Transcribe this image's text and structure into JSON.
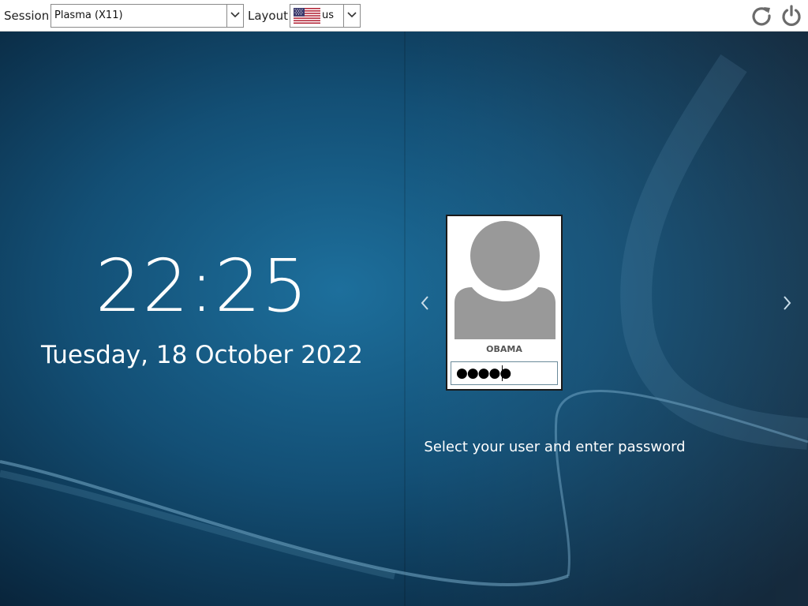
{
  "topbar": {
    "session_label": "Session",
    "session_value": "Plasma (X11)",
    "layout_label": "Layout",
    "layout_value": "us",
    "layout_flag_icon": "us-flag-icon",
    "reboot_icon": "reboot-icon",
    "shutdown_icon": "power-icon"
  },
  "clock": {
    "time": "22:25",
    "date": "Tuesday, 18 October 2022"
  },
  "user_card": {
    "avatar_icon": "user-avatar-icon",
    "username": "OBAMA",
    "password_masked": "●●●●●"
  },
  "navigation": {
    "prev_icon": "chevron-left-icon",
    "next_icon": "chevron-right-icon"
  },
  "hint": "Select your user and enter password",
  "colors": {
    "background_dark": "#0a2c45",
    "background_light": "#1d6f9c",
    "avatar_gray": "#999999",
    "icon_gray": "#6b6b6b"
  }
}
